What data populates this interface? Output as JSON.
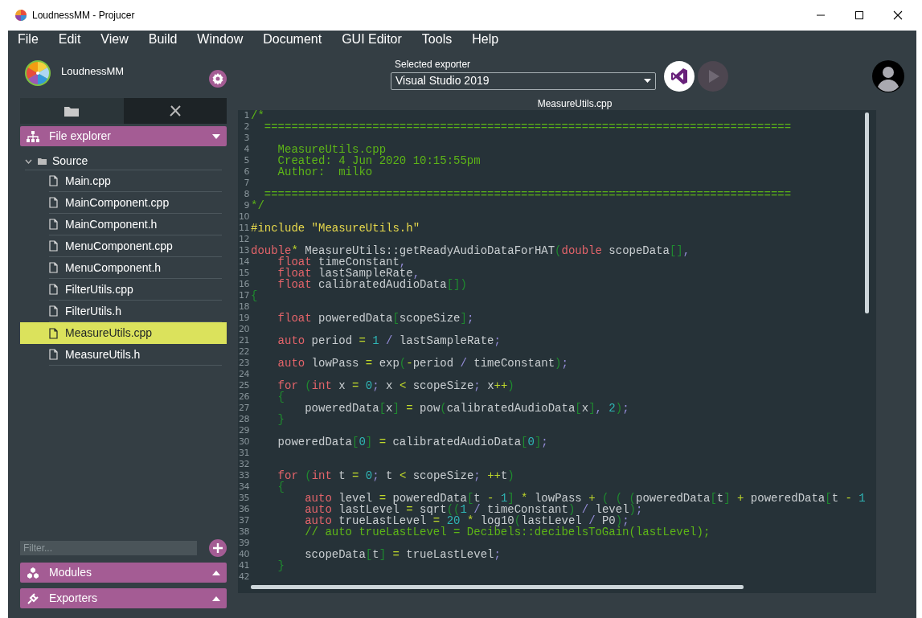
{
  "window": {
    "title": "LoudnessMM - Projucer"
  },
  "menu": [
    "File",
    "Edit",
    "View",
    "Build",
    "Window",
    "Document",
    "GUI Editor",
    "Tools",
    "Help"
  ],
  "project": {
    "name": "LoudnessMM"
  },
  "sidebar_tabs": [
    {
      "kind": "files",
      "selected": true
    },
    {
      "kind": "tools",
      "selected": false
    }
  ],
  "file_explorer": {
    "title": "File explorer",
    "expanded": true,
    "tree": [
      {
        "label": "Source",
        "expanded": true,
        "children": [
          {
            "label": "Main.cpp",
            "selected": false
          },
          {
            "label": "MainComponent.cpp",
            "selected": false
          },
          {
            "label": "MainComponent.h",
            "selected": false
          },
          {
            "label": "MenuComponent.cpp",
            "selected": false
          },
          {
            "label": "MenuComponent.h",
            "selected": false
          },
          {
            "label": "FilterUtils.cpp",
            "selected": false
          },
          {
            "label": "FilterUtils.h",
            "selected": false
          },
          {
            "label": "MeasureUtils.cpp",
            "selected": true
          },
          {
            "label": "MeasureUtils.h",
            "selected": false
          }
        ]
      }
    ]
  },
  "filter": {
    "placeholder": "Filter..."
  },
  "panels": [
    {
      "kind": "modules",
      "title": "Modules",
      "expanded": false
    },
    {
      "kind": "exporters",
      "title": "Exporters",
      "expanded": false
    }
  ],
  "exporter": {
    "label": "Selected exporter",
    "value": "Visual Studio 2019"
  },
  "editor": {
    "title": "MeasureUtils.cpp",
    "lines": [
      {
        "n": "1",
        "tokens": [
          {
            "kind": "comment",
            "text": "/*"
          }
        ]
      },
      {
        "n": "2",
        "tokens": [
          {
            "kind": "comment",
            "text": "  =============================================================================="
          }
        ]
      },
      {
        "n": "3"
      },
      {
        "n": "4",
        "tokens": [
          {
            "kind": "comment",
            "text": "    MeasureUtils.cpp"
          }
        ]
      },
      {
        "n": "5",
        "tokens": [
          {
            "kind": "comment",
            "text": "    Created: 4 Jun 2020 10:15:55pm"
          }
        ]
      },
      {
        "n": "6",
        "tokens": [
          {
            "kind": "comment",
            "text": "    Author:  milko"
          }
        ]
      },
      {
        "n": "7"
      },
      {
        "n": "8",
        "tokens": [
          {
            "kind": "comment",
            "text": "  =============================================================================="
          }
        ]
      },
      {
        "n": "9",
        "tokens": [
          {
            "kind": "comment",
            "text": "*/"
          }
        ]
      },
      {
        "n": "10"
      },
      {
        "n": "11",
        "tokens": [
          {
            "kind": "preproc",
            "text": "#include \"MeasureUtils.h\""
          }
        ]
      },
      {
        "n": "12"
      },
      {
        "n": "13",
        "tokens": [
          {
            "kind": "keyword",
            "text": "double"
          },
          {
            "kind": "operator",
            "text": "*"
          },
          {
            "kind": "plain",
            "text": " MeasureUtils::getReadyAudioDataForHAT"
          },
          {
            "kind": "bracket",
            "text": "("
          },
          {
            "kind": "keyword",
            "text": "double"
          },
          {
            "kind": "plain",
            "text": " scopeData"
          },
          {
            "kind": "bracket",
            "text": "[]"
          },
          {
            "kind": "punct",
            "text": ","
          }
        ]
      },
      {
        "n": "14",
        "tokens": [
          {
            "kind": "keyword",
            "text": "    float"
          },
          {
            "kind": "plain",
            "text": " timeConstant"
          },
          {
            "kind": "punct",
            "text": ","
          }
        ]
      },
      {
        "n": "15",
        "tokens": [
          {
            "kind": "keyword",
            "text": "    float"
          },
          {
            "kind": "plain",
            "text": " lastSampleRate"
          },
          {
            "kind": "punct",
            "text": ","
          }
        ]
      },
      {
        "n": "16",
        "tokens": [
          {
            "kind": "keyword",
            "text": "    float"
          },
          {
            "kind": "plain",
            "text": " calibratedAudioData"
          },
          {
            "kind": "bracket",
            "text": "[])"
          }
        ]
      },
      {
        "n": "17",
        "tokens": [
          {
            "kind": "bracket",
            "text": "{"
          }
        ]
      },
      {
        "n": "18"
      },
      {
        "n": "19",
        "tokens": [
          {
            "kind": "keyword",
            "text": "    float"
          },
          {
            "kind": "plain",
            "text": " poweredData"
          },
          {
            "kind": "bracket",
            "text": "["
          },
          {
            "kind": "plain",
            "text": "scopeSize"
          },
          {
            "kind": "bracket",
            "text": "]"
          },
          {
            "kind": "punct",
            "text": ";"
          }
        ]
      },
      {
        "n": "20"
      },
      {
        "n": "21",
        "tokens": [
          {
            "kind": "keyword",
            "text": "    auto"
          },
          {
            "kind": "plain",
            "text": " period "
          },
          {
            "kind": "operator",
            "text": "="
          },
          {
            "kind": "number",
            "text": " 1"
          },
          {
            "kind": "punct",
            "text": " /"
          },
          {
            "kind": "plain",
            "text": " lastSampleRate"
          },
          {
            "kind": "punct",
            "text": ";"
          }
        ]
      },
      {
        "n": "22"
      },
      {
        "n": "23",
        "tokens": [
          {
            "kind": "keyword",
            "text": "    auto"
          },
          {
            "kind": "plain",
            "text": " lowPass "
          },
          {
            "kind": "operator",
            "text": "="
          },
          {
            "kind": "plain",
            "text": " exp"
          },
          {
            "kind": "bracket",
            "text": "("
          },
          {
            "kind": "operator",
            "text": "-"
          },
          {
            "kind": "plain",
            "text": "period "
          },
          {
            "kind": "punct",
            "text": "/"
          },
          {
            "kind": "plain",
            "text": " timeConstant"
          },
          {
            "kind": "bracket",
            "text": ")"
          },
          {
            "kind": "punct",
            "text": ";"
          }
        ]
      },
      {
        "n": "24"
      },
      {
        "n": "25",
        "tokens": [
          {
            "kind": "keyword",
            "text": "    for"
          },
          {
            "kind": "bracket",
            "text": " ("
          },
          {
            "kind": "keyword",
            "text": "int"
          },
          {
            "kind": "plain",
            "text": " x "
          },
          {
            "kind": "operator",
            "text": "="
          },
          {
            "kind": "number",
            "text": " 0"
          },
          {
            "kind": "punct",
            "text": ";"
          },
          {
            "kind": "plain",
            "text": " x "
          },
          {
            "kind": "operator",
            "text": "<"
          },
          {
            "kind": "plain",
            "text": " scopeSize"
          },
          {
            "kind": "punct",
            "text": ";"
          },
          {
            "kind": "plain",
            "text": " x"
          },
          {
            "kind": "operator",
            "text": "++"
          },
          {
            "kind": "bracket",
            "text": ")"
          }
        ]
      },
      {
        "n": "26",
        "tokens": [
          {
            "kind": "bracket",
            "text": "    {"
          }
        ]
      },
      {
        "n": "27",
        "tokens": [
          {
            "kind": "plain",
            "text": "        poweredData"
          },
          {
            "kind": "bracket",
            "text": "["
          },
          {
            "kind": "plain",
            "text": "x"
          },
          {
            "kind": "bracket",
            "text": "]"
          },
          {
            "kind": "operator",
            "text": " ="
          },
          {
            "kind": "plain",
            "text": " pow"
          },
          {
            "kind": "bracket",
            "text": "("
          },
          {
            "kind": "plain",
            "text": "calibratedAudioData"
          },
          {
            "kind": "bracket",
            "text": "["
          },
          {
            "kind": "plain",
            "text": "x"
          },
          {
            "kind": "bracket",
            "text": "]"
          },
          {
            "kind": "punct",
            "text": ","
          },
          {
            "kind": "number",
            "text": " 2"
          },
          {
            "kind": "bracket",
            "text": ")"
          },
          {
            "kind": "punct",
            "text": ";"
          }
        ]
      },
      {
        "n": "28",
        "tokens": [
          {
            "kind": "bracket",
            "text": "    }"
          }
        ]
      },
      {
        "n": "29"
      },
      {
        "n": "30",
        "tokens": [
          {
            "kind": "plain",
            "text": "    poweredData"
          },
          {
            "kind": "bracket",
            "text": "["
          },
          {
            "kind": "number",
            "text": "0"
          },
          {
            "kind": "bracket",
            "text": "]"
          },
          {
            "kind": "operator",
            "text": " ="
          },
          {
            "kind": "plain",
            "text": " calibratedAudioData"
          },
          {
            "kind": "bracket",
            "text": "["
          },
          {
            "kind": "number",
            "text": "0"
          },
          {
            "kind": "bracket",
            "text": "]"
          },
          {
            "kind": "punct",
            "text": ";"
          }
        ]
      },
      {
        "n": "31"
      },
      {
        "n": "32"
      },
      {
        "n": "33",
        "tokens": [
          {
            "kind": "keyword",
            "text": "    for"
          },
          {
            "kind": "bracket",
            "text": " ("
          },
          {
            "kind": "keyword",
            "text": "int"
          },
          {
            "kind": "plain",
            "text": " t "
          },
          {
            "kind": "operator",
            "text": "="
          },
          {
            "kind": "number",
            "text": " 0"
          },
          {
            "kind": "punct",
            "text": ";"
          },
          {
            "kind": "plain",
            "text": " t "
          },
          {
            "kind": "operator",
            "text": "<"
          },
          {
            "kind": "plain",
            "text": " scopeSize"
          },
          {
            "kind": "punct",
            "text": ";"
          },
          {
            "kind": "operator",
            "text": " ++"
          },
          {
            "kind": "plain",
            "text": "t"
          },
          {
            "kind": "bracket",
            "text": ")"
          }
        ]
      },
      {
        "n": "34",
        "tokens": [
          {
            "kind": "bracket",
            "text": "    {"
          }
        ]
      },
      {
        "n": "35",
        "tokens": [
          {
            "kind": "keyword",
            "text": "        auto"
          },
          {
            "kind": "plain",
            "text": " level "
          },
          {
            "kind": "operator",
            "text": "="
          },
          {
            "kind": "plain",
            "text": " poweredData"
          },
          {
            "kind": "bracket",
            "text": "["
          },
          {
            "kind": "plain",
            "text": "t "
          },
          {
            "kind": "operator",
            "text": "-"
          },
          {
            "kind": "number",
            "text": " 1"
          },
          {
            "kind": "bracket",
            "text": "]"
          },
          {
            "kind": "operator",
            "text": " *"
          },
          {
            "kind": "plain",
            "text": " lowPass "
          },
          {
            "kind": "operator",
            "text": "+"
          },
          {
            "kind": "bracket",
            "text": " ( ( ("
          },
          {
            "kind": "plain",
            "text": "poweredData"
          },
          {
            "kind": "bracket",
            "text": "["
          },
          {
            "kind": "plain",
            "text": "t"
          },
          {
            "kind": "bracket",
            "text": "]"
          },
          {
            "kind": "operator",
            "text": " +"
          },
          {
            "kind": "plain",
            "text": " poweredData"
          },
          {
            "kind": "bracket",
            "text": "["
          },
          {
            "kind": "plain",
            "text": "t "
          },
          {
            "kind": "operator",
            "text": "-"
          },
          {
            "kind": "number",
            "text": " 1"
          }
        ]
      },
      {
        "n": "36",
        "tokens": [
          {
            "kind": "keyword",
            "text": "        auto"
          },
          {
            "kind": "plain",
            "text": " lastLevel "
          },
          {
            "kind": "operator",
            "text": "="
          },
          {
            "kind": "plain",
            "text": " sqrt"
          },
          {
            "kind": "bracket",
            "text": "(("
          },
          {
            "kind": "number",
            "text": "1"
          },
          {
            "kind": "punct",
            "text": " /"
          },
          {
            "kind": "plain",
            "text": " timeConstant"
          },
          {
            "kind": "bracket",
            "text": ")"
          },
          {
            "kind": "punct",
            "text": " /"
          },
          {
            "kind": "plain",
            "text": " level"
          },
          {
            "kind": "bracket",
            "text": ")"
          },
          {
            "kind": "punct",
            "text": ";"
          }
        ]
      },
      {
        "n": "37",
        "tokens": [
          {
            "kind": "keyword",
            "text": "        auto"
          },
          {
            "kind": "plain",
            "text": " trueLastLevel "
          },
          {
            "kind": "operator",
            "text": "="
          },
          {
            "kind": "number",
            "text": " 20"
          },
          {
            "kind": "operator",
            "text": " *"
          },
          {
            "kind": "plain",
            "text": " log10"
          },
          {
            "kind": "bracket",
            "text": "("
          },
          {
            "kind": "plain",
            "text": "lastLevel "
          },
          {
            "kind": "punct",
            "text": "/"
          },
          {
            "kind": "plain",
            "text": " P0"
          },
          {
            "kind": "bracket",
            "text": ")"
          },
          {
            "kind": "punct",
            "text": ";"
          }
        ]
      },
      {
        "n": "38",
        "tokens": [
          {
            "kind": "comment",
            "text": "        // auto trueLastLevel = Decibels::decibelsToGain(lastLevel);"
          }
        ]
      },
      {
        "n": "39"
      },
      {
        "n": "40",
        "tokens": [
          {
            "kind": "plain",
            "text": "        scopeData"
          },
          {
            "kind": "bracket",
            "text": "["
          },
          {
            "kind": "plain",
            "text": "t"
          },
          {
            "kind": "bracket",
            "text": "]"
          },
          {
            "kind": "operator",
            "text": " ="
          },
          {
            "kind": "plain",
            "text": " trueLastLevel"
          },
          {
            "kind": "punct",
            "text": ";"
          }
        ]
      },
      {
        "n": "41",
        "tokens": [
          {
            "kind": "bracket",
            "text": "    }"
          }
        ]
      },
      {
        "n": "42"
      }
    ]
  }
}
